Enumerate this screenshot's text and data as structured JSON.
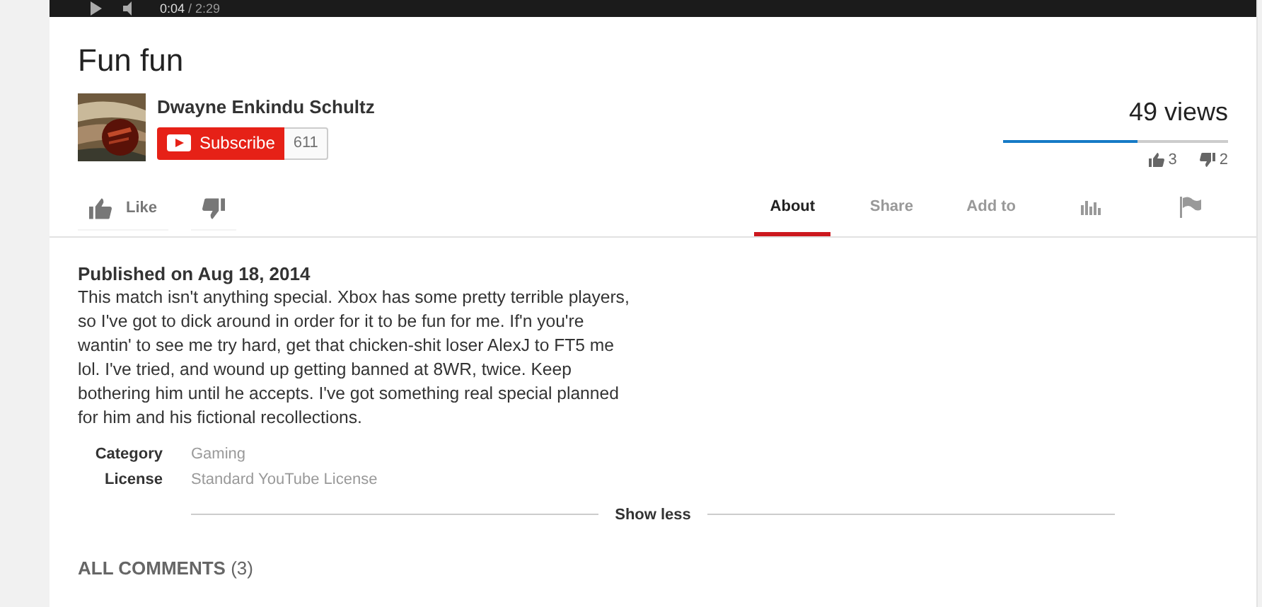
{
  "player": {
    "time_current": "0:04",
    "time_total": "/ 2:29"
  },
  "video": {
    "title": "Fun fun",
    "channel": "Dwayne Enkindu Schultz",
    "subscribe_label": "Subscribe",
    "subscriber_count": "611",
    "views": "49 views",
    "sentiment": {
      "level": 0.6
    },
    "likes": "3",
    "dislikes": "2"
  },
  "actions": {
    "like_label": "Like",
    "tabs": [
      {
        "kind": "text",
        "label": "About",
        "selected": true
      },
      {
        "kind": "text",
        "label": "Share",
        "selected": false
      },
      {
        "kind": "text",
        "label": "Add to",
        "selected": false
      },
      {
        "kind": "stats",
        "selected": false
      },
      {
        "kind": "flag",
        "selected": false
      }
    ]
  },
  "description": {
    "published": "Published on Aug 18, 2014",
    "text": "This match isn't anything special. Xbox has some pretty terrible players, so I've got to dick around in order for it to be fun for me. If'n you're wantin' to see me try hard, get that chicken-shit loser AlexJ to FT5 me lol. I've tried, and wound up getting banned at 8WR, twice. Keep bothering him until he accepts. I've got something real special planned for him and his fictional recollections.",
    "meta": [
      {
        "label": "Category",
        "value": "Gaming"
      },
      {
        "label": "License",
        "value": "Standard YouTube License"
      }
    ],
    "toggle_label": "Show less"
  },
  "comments": {
    "heading": "ALL COMMENTS",
    "count": "(3)"
  }
}
